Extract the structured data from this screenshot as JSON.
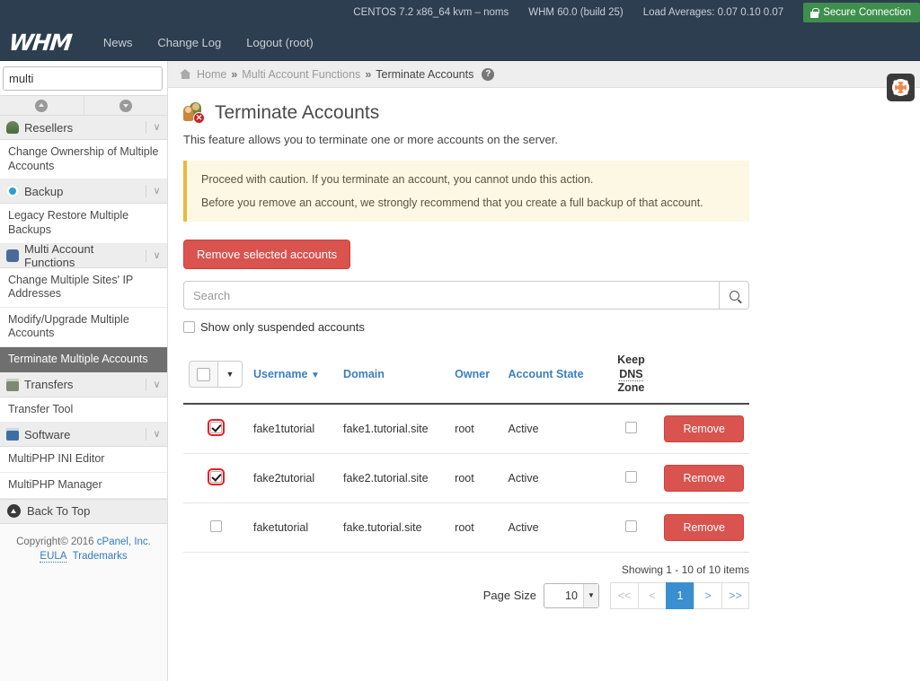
{
  "topbar": {
    "server_info": "CENTOS 7.2 x86_64 kvm – noms",
    "whm_version": "WHM 60.0 (build 25)",
    "load_averages": "Load Averages: 0.07 0.10 0.07",
    "secure_connection": "Secure Connection",
    "logo": "WHM",
    "nav": [
      {
        "label": "News"
      },
      {
        "label": "Change Log"
      },
      {
        "label": "Logout (root)"
      }
    ]
  },
  "sidebar": {
    "search_value": "multi",
    "search_placeholder": "",
    "clear_label": "✕",
    "groups": [
      {
        "label": "Resellers",
        "caret": "∨",
        "icon": "resellers-icon"
      },
      {
        "label": "Backup",
        "caret": "∨",
        "icon": "backup-icon"
      },
      {
        "label": "Multi Account Functions",
        "caret": "∨",
        "icon": "multi-account-icon"
      },
      {
        "label": "Transfers",
        "caret": "∨",
        "icon": "transfers-icon"
      },
      {
        "label": "Software",
        "caret": "∨",
        "icon": "software-icon"
      }
    ],
    "items": {
      "resellers": [
        "Change Ownership of Multiple Accounts"
      ],
      "backup": [
        "Legacy Restore Multiple Backups"
      ],
      "multi": [
        "Change Multiple Sites' IP Addresses",
        "Modify/Upgrade Multiple Accounts",
        "Terminate Multiple Accounts"
      ],
      "transfers": [
        "Transfer Tool"
      ],
      "software": [
        "MultiPHP INI Editor",
        "MultiPHP Manager"
      ]
    },
    "active_item": "Terminate Multiple Accounts",
    "back_to_top": "Back To Top",
    "copyright_prefix": "Copyright© 2016 ",
    "copyright_company": "cPanel, Inc.",
    "eula": "EULA",
    "trademarks": "Trademarks"
  },
  "breadcrumb": {
    "home": "Home",
    "sep": "»",
    "parent": "Multi Account Functions",
    "current": "Terminate Accounts",
    "help": "?"
  },
  "page": {
    "title": "Terminate Accounts",
    "description": "This feature allows you to terminate one or more accounts on the server.",
    "warning_line1": "Proceed with caution. If you terminate an account, you cannot undo this action.",
    "warning_line2": "Before you remove an account, we strongly recommend that you create a full backup of that account."
  },
  "toolbar": {
    "remove_selected_label": "Remove selected accounts",
    "search_placeholder": "Search",
    "search_value": "",
    "suspended_filter_label": "Show only suspended accounts",
    "suspended_filter_checked": false
  },
  "table": {
    "columns": {
      "select": "",
      "username": "Username",
      "username_sort": "▼",
      "domain": "Domain",
      "owner": "Owner",
      "account_state": "Account State",
      "keep_dns_prefix": "Keep ",
      "keep_dns_abbr": "DNS",
      "keep_dns_suffix": " Zone",
      "action": ""
    },
    "select_all_checked": false,
    "select_all_caret": "▼",
    "rows": [
      {
        "selected": true,
        "username": "fake1tutorial",
        "domain": "fake1.tutorial.site",
        "owner": "root",
        "account_state": "Active",
        "keep_dns_zone": false,
        "action_label": "Remove"
      },
      {
        "selected": true,
        "username": "fake2tutorial",
        "domain": "fake2.tutorial.site",
        "owner": "root",
        "account_state": "Active",
        "keep_dns_zone": false,
        "action_label": "Remove"
      },
      {
        "selected": false,
        "username": "faketutorial",
        "domain": "fake.tutorial.site",
        "owner": "root",
        "account_state": "Active",
        "keep_dns_zone": false,
        "action_label": "Remove"
      }
    ]
  },
  "pagination": {
    "showing": "Showing 1 - 10 of 10 items",
    "page_size_label": "Page Size",
    "page_size_value": "10",
    "page_size_caret": "▼",
    "first": "<<",
    "prev": "<",
    "current_page": "1",
    "next": ">",
    "last": ">>"
  },
  "help_fab": {
    "name": "life-ring-help-button"
  },
  "colors": {
    "header_dark": "#2d3e50",
    "danger_red": "#d9534f",
    "link_blue": "#337ab7",
    "warning_bg": "#fcf8e3",
    "warning_border": "#e8bb3f",
    "secure_green": "#3e8f4e",
    "active_page_blue": "#3a8fd0",
    "focus_red": "#ee1c25"
  }
}
